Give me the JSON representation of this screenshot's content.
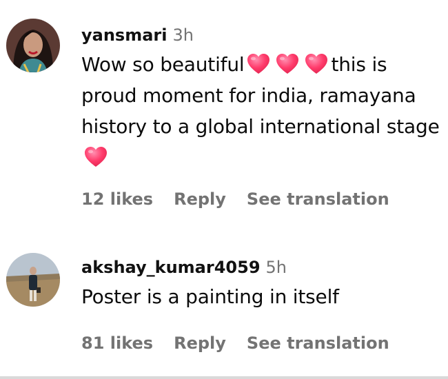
{
  "comments": [
    {
      "username": "yansmari",
      "time": "3h",
      "text_parts": [
        "Wow so beautiful",
        "this is proud moment for india, ramayana history to a global international stage"
      ],
      "emoji": "heart-emoji",
      "likes": "12 likes",
      "reply": "Reply",
      "translation": "See translation"
    },
    {
      "username": "akshay_kumar4059",
      "time": "5h",
      "text": "Poster is a painting in itself",
      "likes": "81 likes",
      "reply": "Reply",
      "translation": "See translation"
    }
  ],
  "colors": {
    "secondary_text": "#737373",
    "heart": "#ff3b6b"
  }
}
